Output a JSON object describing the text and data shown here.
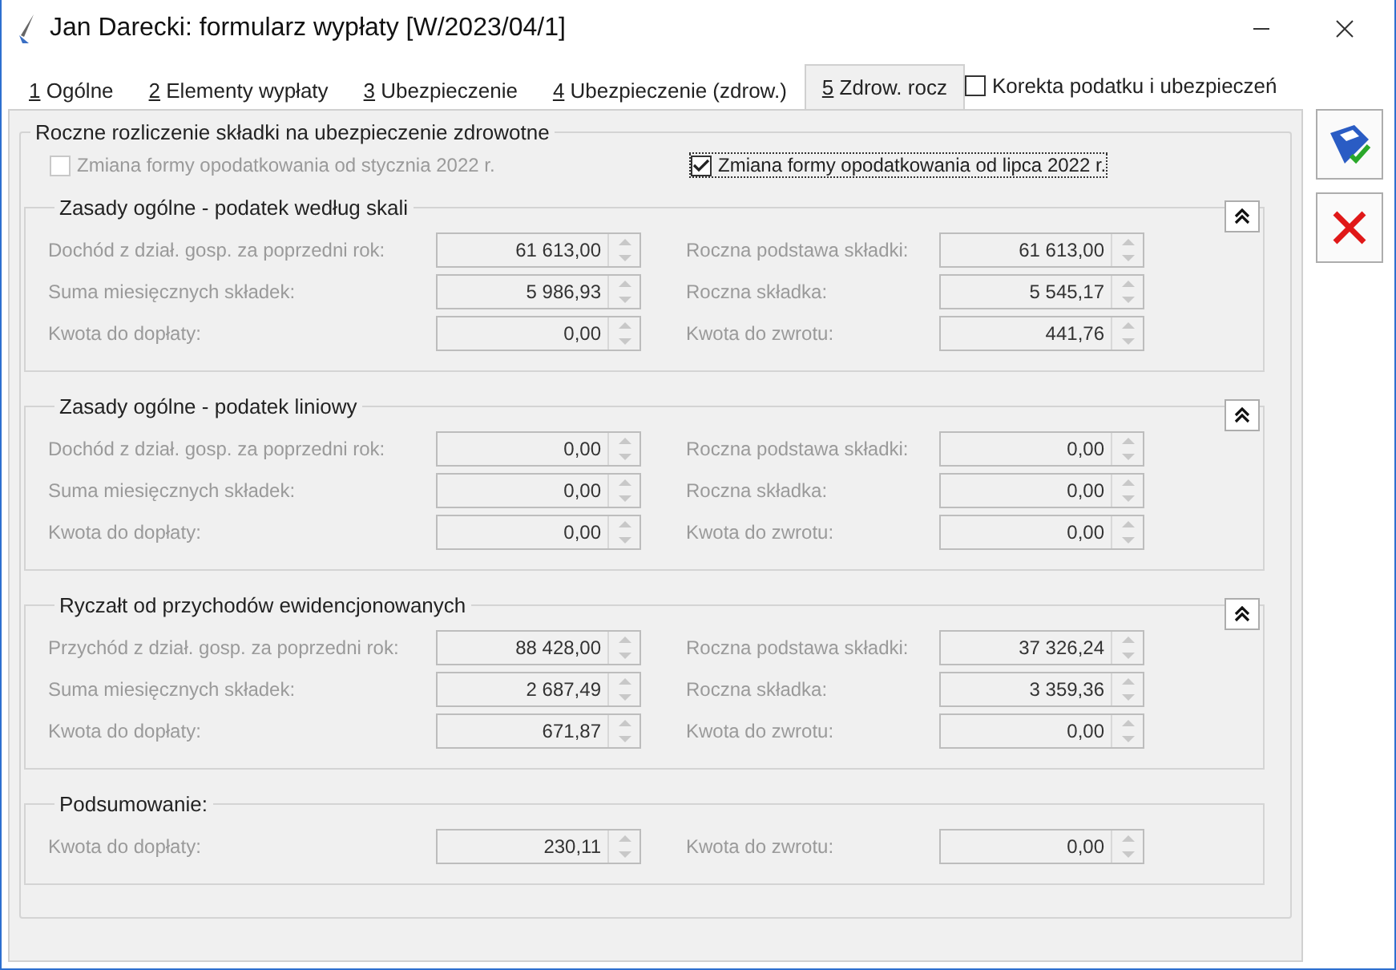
{
  "window": {
    "title": "Jan Darecki: formularz wypłaty [W/2023/04/1]"
  },
  "tabs": [
    {
      "key": "1",
      "label": "Ogólne",
      "selected": false
    },
    {
      "key": "2",
      "label": "Elementy wypłaty",
      "selected": false
    },
    {
      "key": "3",
      "label": "Ubezpieczenie",
      "selected": false
    },
    {
      "key": "4",
      "label": "Ubezpieczenie (zdrow.)",
      "selected": false
    },
    {
      "key": "5",
      "label": "Zdrow. rocz",
      "selected": true
    }
  ],
  "correction": {
    "label": "Korekta podatku i ubezpieczeń",
    "checked": false
  },
  "panel": {
    "title": "Roczne rozliczenie składki na ubezpieczenie zdrowotne",
    "options": [
      {
        "label": "Zmiana formy opodatkowania od stycznia 2022 r.",
        "checked": false,
        "disabled": true,
        "focused": false
      },
      {
        "label": "Zmiana formy opodatkowania od lipca 2022 r.",
        "checked": true,
        "disabled": false,
        "focused": true
      }
    ],
    "sections": [
      {
        "title": "Zasady ogólne - podatek według skali",
        "collapsible": true,
        "rows": [
          {
            "left": {
              "label": "Dochód z dział. gosp. za poprzedni rok:",
              "value": "61 613,00"
            },
            "right": {
              "label": "Roczna podstawa składki:",
              "value": "61 613,00"
            }
          },
          {
            "left": {
              "label": "Suma miesięcznych składek:",
              "value": "5 986,93"
            },
            "right": {
              "label": "Roczna składka:",
              "value": "5 545,17"
            }
          },
          {
            "left": {
              "label": "Kwota do dopłaty:",
              "value": "0,00"
            },
            "right": {
              "label": "Kwota do zwrotu:",
              "value": "441,76"
            }
          }
        ]
      },
      {
        "title": "Zasady ogólne - podatek liniowy",
        "collapsible": true,
        "rows": [
          {
            "left": {
              "label": "Dochód z dział. gosp. za poprzedni rok:",
              "value": "0,00"
            },
            "right": {
              "label": "Roczna podstawa składki:",
              "value": "0,00"
            }
          },
          {
            "left": {
              "label": "Suma miesięcznych składek:",
              "value": "0,00"
            },
            "right": {
              "label": "Roczna składka:",
              "value": "0,00"
            }
          },
          {
            "left": {
              "label": "Kwota do dopłaty:",
              "value": "0,00"
            },
            "right": {
              "label": "Kwota do zwrotu:",
              "value": "0,00"
            }
          }
        ]
      },
      {
        "title": "Ryczałt od przychodów ewidencjonowanych",
        "collapsible": true,
        "rows": [
          {
            "left": {
              "label": "Przychód z dział. gosp. za poprzedni rok:",
              "value": "88 428,00"
            },
            "right": {
              "label": "Roczna podstawa składki:",
              "value": "37 326,24"
            }
          },
          {
            "left": {
              "label": "Suma miesięcznych składek:",
              "value": "2 687,49"
            },
            "right": {
              "label": "Roczna składka:",
              "value": "3 359,36"
            }
          },
          {
            "left": {
              "label": "Kwota do dopłaty:",
              "value": "671,87"
            },
            "right": {
              "label": "Kwota do zwrotu:",
              "value": "0,00"
            }
          }
        ]
      },
      {
        "title": "Podsumowanie:",
        "collapsible": false,
        "rows": [
          {
            "left": {
              "label": "Kwota do dopłaty:",
              "value": "230,11"
            },
            "right": {
              "label": "Kwota do zwrotu:",
              "value": "0,00"
            }
          }
        ]
      }
    ]
  }
}
